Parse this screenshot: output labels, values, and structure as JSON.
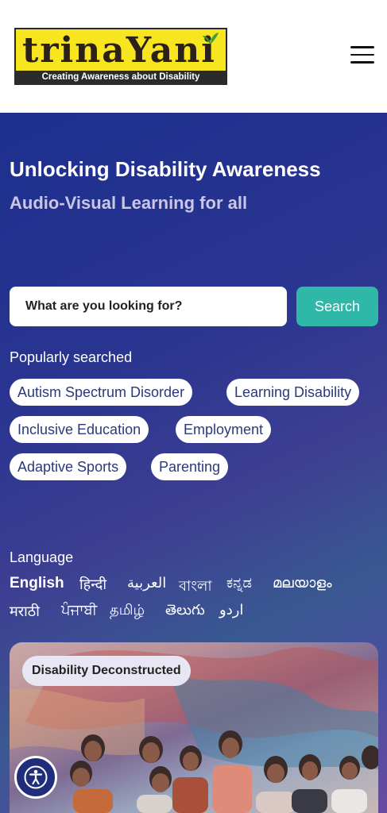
{
  "header": {
    "logo_word": "trinaYani",
    "logo_tagline": "Creating Awareness about Disability",
    "menu_icon": "hamburger-icon"
  },
  "hero": {
    "title": "Unlocking Disability Awareness",
    "subtitle": "Audio-Visual Learning for all"
  },
  "search": {
    "placeholder": "What are you looking for?",
    "button_label": "Search"
  },
  "popular": {
    "label": "Popularly searched",
    "chips": [
      "Autism Spectrum Disorder",
      "Learning Disability",
      "Inclusive Education",
      "Employment",
      "Adaptive Sports",
      "Parenting"
    ]
  },
  "language": {
    "label": "Language",
    "items": [
      "English",
      "हिन्दी",
      "العربية",
      "বাংলা",
      "ಕನ್ನಡ",
      "മലയാളം",
      "मराठी",
      "ਪੰਜਾਬੀ",
      "தமிழ்",
      "తెలుగు",
      "اردو"
    ],
    "active": "English"
  },
  "card": {
    "badge": "Disability Deconstructed"
  },
  "accessibility": {
    "icon": "accessibility-icon"
  },
  "colors": {
    "accent": "#2fb7a8",
    "hero_start": "#1d2f8e",
    "logo_bg": "#f7e51f",
    "chip_text": "#2a3a7a"
  }
}
